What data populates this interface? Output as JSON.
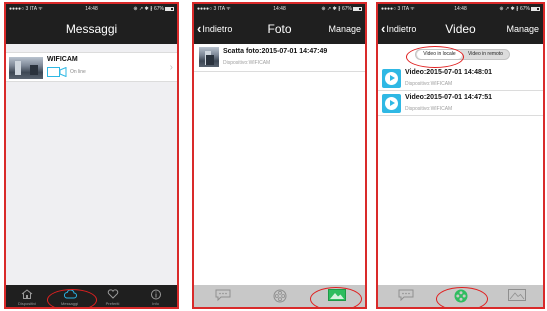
{
  "status_bar": {
    "carrier": "●●●●○ 3 ITA ᯤ",
    "time": "14:48",
    "right_status": "⊕ ↗ ✱ ∦ 67%"
  },
  "screens": {
    "messages": {
      "title": "Messaggi",
      "device": {
        "name": "WIFICAM",
        "status": "On line"
      },
      "tabs": [
        {
          "label": "Dispositivi",
          "icon": "home-icon"
        },
        {
          "label": "Messaggi",
          "icon": "cloud-icon"
        },
        {
          "label": "Preferiti",
          "icon": "heart-icon"
        },
        {
          "label": "Info",
          "icon": "info-icon"
        }
      ]
    },
    "photo": {
      "back_label": "Indietro",
      "title": "Foto",
      "manage_label": "Manage",
      "items": [
        {
          "title": "Scatta foto:2015-07-01 14:47:49",
          "device": "Dispositivo:WIFICAM"
        }
      ],
      "tabs": [
        {
          "icon": "chat-icon"
        },
        {
          "icon": "film-reel-icon"
        },
        {
          "icon": "image-icon",
          "active": true
        }
      ]
    },
    "video": {
      "back_label": "Indietro",
      "title": "Video",
      "manage_label": "Manage",
      "segment": {
        "local": "Video in locale",
        "remote": "Video in remoto",
        "selected": "local"
      },
      "items": [
        {
          "title": "Video:2015-07-01 14:48:01",
          "device": "Dispositivo:WIFICAM"
        },
        {
          "title": "Video:2015-07-01 14:47:51",
          "device": "Dispositivo:WIFICAM"
        }
      ],
      "tabs": [
        {
          "icon": "chat-icon"
        },
        {
          "icon": "film-reel-icon",
          "active": true
        },
        {
          "icon": "image-icon"
        }
      ]
    }
  },
  "colors": {
    "bar_dark": "#1f1f1f",
    "annotation_red": "#e02020",
    "accent_green": "#2ebd5f",
    "play_blue": "#2fb8e4"
  }
}
